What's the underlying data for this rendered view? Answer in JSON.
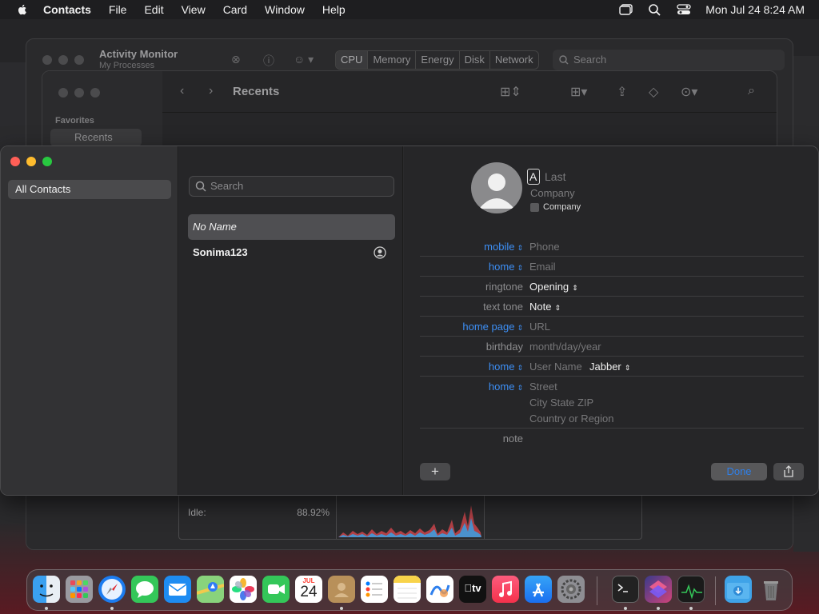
{
  "menubar": {
    "app_name": "Contacts",
    "items": [
      "File",
      "Edit",
      "View",
      "Card",
      "Window",
      "Help"
    ],
    "clock": "Mon Jul 24  8:24 AM"
  },
  "activity_monitor": {
    "title": "Activity Monitor",
    "subtitle": "My Processes",
    "tabs": [
      "CPU",
      "Memory",
      "Energy",
      "Disk",
      "Network"
    ],
    "active_tab": "CPU",
    "search_placeholder": "Search",
    "idle_label": "Idle:",
    "idle_value": "88.92%",
    "chart_colors": {
      "system": "#e0484f",
      "user": "#3f9bdc"
    }
  },
  "finder": {
    "title": "Recents",
    "favorites_label": "Favorites",
    "sidebar_item": "Recents"
  },
  "contacts": {
    "groups": [
      "All Contacts"
    ],
    "search_placeholder": "Search",
    "list": [
      {
        "name": "No Name",
        "selected": true
      },
      {
        "name": "Sonima123",
        "selected": false
      }
    ],
    "card": {
      "first_name": "A",
      "last_name_placeholder": "Last",
      "company_placeholder": "Company",
      "company_checkbox_label": "Company",
      "fields": [
        {
          "label": "mobile",
          "value": "Phone"
        },
        {
          "label": "home",
          "value": "Email"
        },
        {
          "label": "ringtone",
          "value": "Opening"
        },
        {
          "label": "text tone",
          "value": "Note"
        },
        {
          "label": "home page",
          "value": "URL"
        },
        {
          "label": "birthday",
          "value": "month/day/year"
        },
        {
          "label": "home",
          "value": "User Name",
          "extra": "Jabber"
        },
        {
          "label": "home",
          "value": "Street"
        },
        {
          "label": "note",
          "value": ""
        }
      ],
      "address_lines": [
        "City  State  ZIP",
        "Country or Region"
      ],
      "add_button": "+",
      "done_button": "Done"
    }
  },
  "dock": {
    "calendar_month": "JUL",
    "calendar_day": "24",
    "tv_label": "tv",
    "apps": [
      "Finder",
      "Launchpad",
      "Safari",
      "Messages",
      "Mail",
      "Maps",
      "Photos",
      "FaceTime",
      "Calendar",
      "Contacts",
      "Reminders",
      "Notes",
      "Freeform",
      "TV",
      "Music",
      "App Store",
      "System Settings",
      "Terminal",
      "Shortcuts",
      "Activity Monitor",
      "Downloads",
      "Trash"
    ]
  }
}
